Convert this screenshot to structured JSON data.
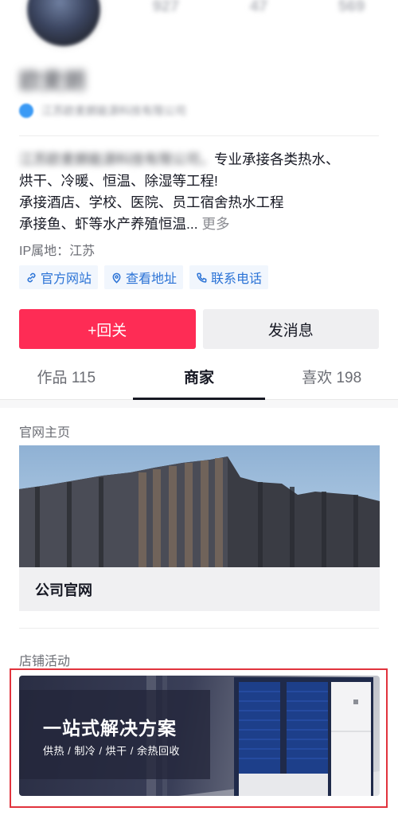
{
  "profile": {
    "name": "欧麦朗",
    "verify_text": "江苏欧麦朗能源科技有限公司",
    "stats": [
      "927",
      "47",
      "569"
    ]
  },
  "bio": {
    "blurred_prefix": "江苏欧麦朗能源科技有限公司，",
    "line1_rest": "专业承接各类热水、",
    "line2": "烘干、冷暖、恒温、除湿等工程!",
    "line3": "承接酒店、学校、医院、员工宿舍热水工程",
    "line4": "承接鱼、虾等水产养殖恒温...",
    "more": "更多"
  },
  "ip_location": "IP属地：江苏",
  "tags": [
    {
      "label": "官方网站",
      "icon": "link-icon"
    },
    {
      "label": "查看地址",
      "icon": "location-icon"
    },
    {
      "label": "联系电话",
      "icon": "phone-icon"
    }
  ],
  "actions": {
    "follow_label": "+回关",
    "message_label": "发消息"
  },
  "tabs": [
    {
      "label": "作品 115"
    },
    {
      "label": "商家",
      "active": true
    },
    {
      "label": "喜欢 198"
    }
  ],
  "sections": {
    "website_title": "官网主页",
    "website_card_label": "公司官网",
    "store_title": "店铺活动",
    "promo_title": "一站式解决方案",
    "promo_subtitle": "供热 / 制冷 / 烘干 / 余热回收"
  },
  "colors": {
    "accent": "#fe2c55",
    "tag_text": "#2b73d6",
    "highlight_border": "#e1333d"
  }
}
